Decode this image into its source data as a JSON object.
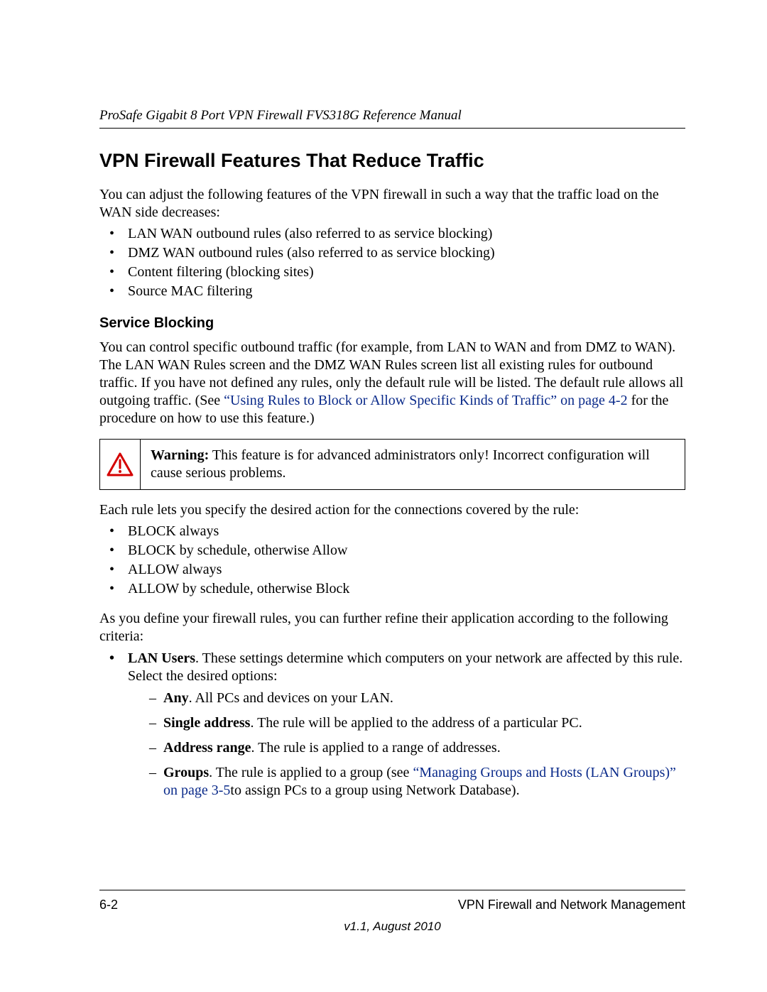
{
  "header": {
    "running_head": "ProSafe Gigabit 8 Port VPN Firewall FVS318G Reference Manual"
  },
  "title": "VPN Firewall Features That Reduce Traffic",
  "intro": "You can adjust the following features of the VPN firewall in such a way that the traffic load on the WAN side decreases:",
  "feature_bullets": [
    "LAN WAN outbound rules (also referred to as service blocking)",
    "DMZ WAN outbound rules (also referred to as service blocking)",
    "Content filtering (blocking sites)",
    "Source MAC filtering"
  ],
  "service_blocking": {
    "heading": "Service Blocking",
    "para_pre": "You can control specific outbound traffic (for example, from LAN to WAN and from DMZ to WAN). The LAN WAN Rules screen and the DMZ WAN Rules screen list all existing rules for outbound traffic. If you have not defined any rules, only the default rule will be listed. The default rule allows all outgoing traffic. (See ",
    "link": "“Using Rules to Block or Allow Specific Kinds of Traffic” on page 4-2",
    "para_post": " for the procedure on how to use this feature.)"
  },
  "warning": {
    "label": "Warning:",
    "text": " This feature is for advanced administrators only! Incorrect configuration will cause serious problems."
  },
  "rule_intro": "Each rule lets you specify the desired action for the connections covered by the rule:",
  "rule_actions": [
    "BLOCK always",
    "BLOCK by schedule, otherwise Allow",
    "ALLOW always",
    "ALLOW by schedule, otherwise Block"
  ],
  "refine_intro": "As you define your firewall rules, you can further refine their application according to the following criteria:",
  "lan_users": {
    "lead_bold": "LAN Users",
    "lead_rest": ". These settings determine which computers on your network are affected by this rule. Select the desired options:",
    "options": {
      "any": {
        "bold": "Any",
        "rest": ". All PCs and devices on your LAN."
      },
      "single": {
        "bold": "Single address",
        "rest": ". The rule will be applied to the address of a particular PC."
      },
      "range": {
        "bold": "Address range",
        "rest": ". The rule is applied to a range of addresses."
      },
      "groups": {
        "bold": "Groups",
        "pre": ". The rule is applied to a group (see ",
        "link": "“Managing Groups and Hosts (LAN Groups)” on page 3-5",
        "post": "to assign PCs to a group using Network Database)."
      }
    }
  },
  "footer": {
    "page_num": "6-2",
    "chapter": "VPN Firewall and Network Management",
    "version": "v1.1, August 2010"
  }
}
